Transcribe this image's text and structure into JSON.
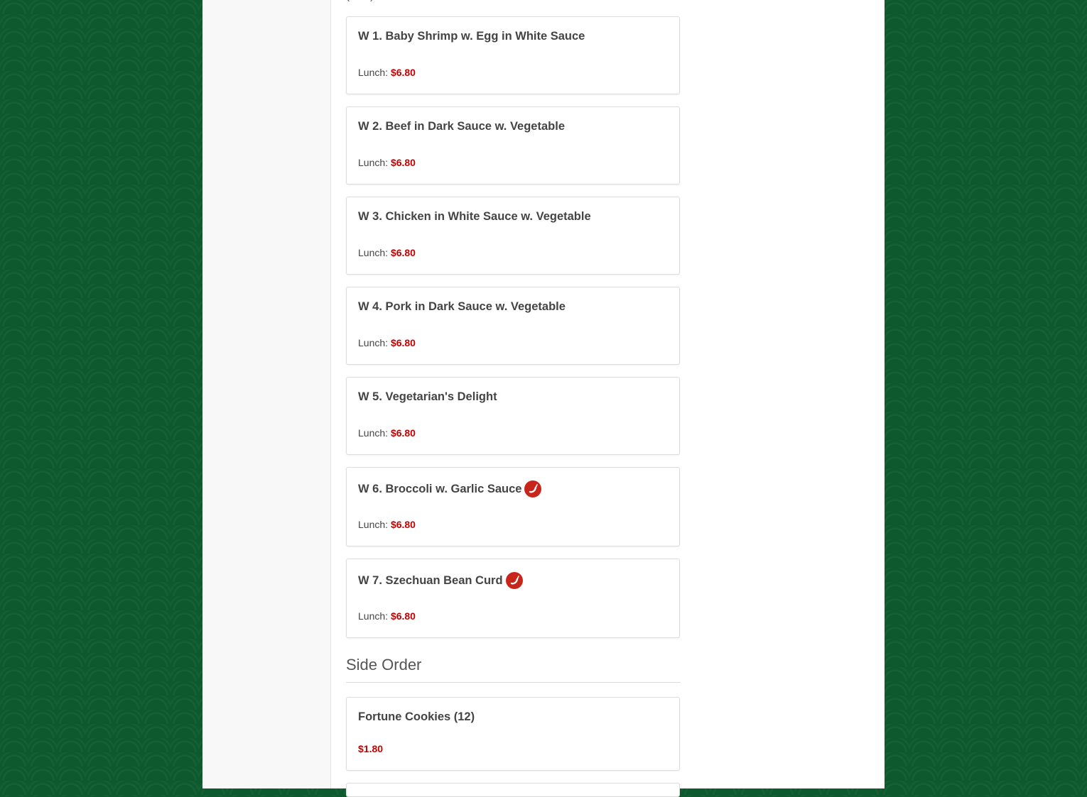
{
  "top_fragment": "(... ...)",
  "items": [
    {
      "title": "W 1. Baby Shrimp w. Egg in White Sauce",
      "price_label": "Lunch:",
      "price": "$6.80",
      "spicy": false
    },
    {
      "title": "W 2. Beef in Dark Sauce w. Vegetable",
      "price_label": "Lunch:",
      "price": "$6.80",
      "spicy": false
    },
    {
      "title": "W 3. Chicken in White Sauce w. Vegetable",
      "price_label": "Lunch:",
      "price": "$6.80",
      "spicy": false
    },
    {
      "title": "W 4. Pork in Dark Sauce w. Vegetable",
      "price_label": "Lunch:",
      "price": "$6.80",
      "spicy": false
    },
    {
      "title": "W 5. Vegetarian's Delight",
      "price_label": "Lunch:",
      "price": "$6.80",
      "spicy": false
    },
    {
      "title": "W 6. Broccoli w. Garlic Sauce",
      "price_label": "Lunch:",
      "price": "$6.80",
      "spicy": true
    },
    {
      "title": "W 7. Szechuan Bean Curd",
      "price_label": "Lunch:",
      "price": "$6.80",
      "spicy": true
    }
  ],
  "side_order": {
    "heading": "Side Order",
    "items": [
      {
        "title": "Fortune Cookies (12)",
        "price": "$1.80"
      }
    ]
  },
  "colors": {
    "price": "#c40000",
    "background": "#0e5a2e",
    "spicy_badge": "#c8251b"
  },
  "icons": {
    "spicy": "chili-pepper-icon"
  }
}
